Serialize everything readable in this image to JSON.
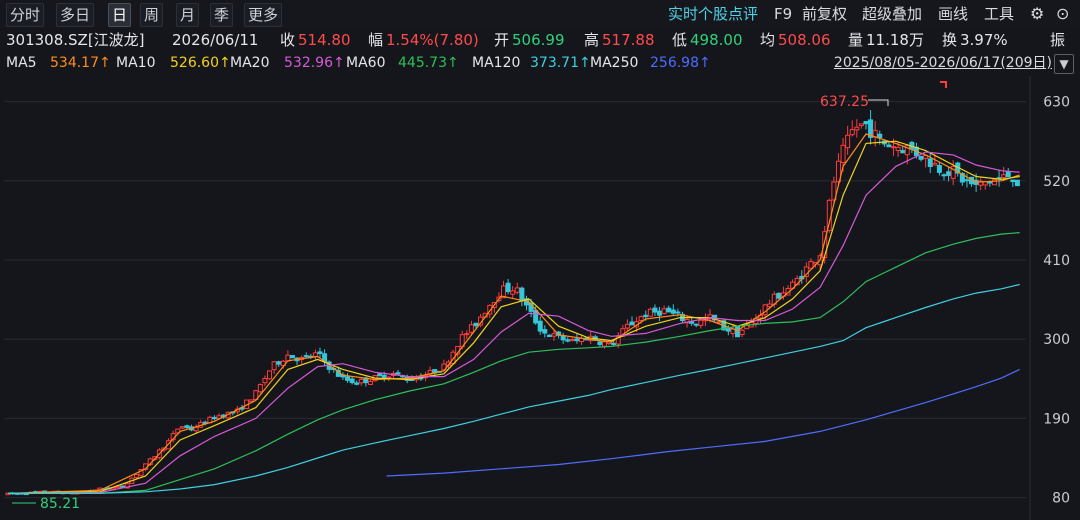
{
  "toolbar": {
    "tabs": [
      "分时",
      "多日",
      "日",
      "周",
      "月",
      "季",
      "更多"
    ],
    "active_tab": "日",
    "tools": [
      "实时个股点评",
      "F9",
      "前复权",
      "超级叠加",
      "画线",
      "工具"
    ],
    "gear_icon": "gear-icon",
    "chevron_icon": "chevron-down-icon"
  },
  "quote": {
    "code": "301308.SZ[江波龙]",
    "date": "2026/06/11",
    "close_label": "收",
    "close": "514.80",
    "change_label": "幅",
    "change": "1.54%(7.80)",
    "open_label": "开",
    "open": "506.99",
    "high_label": "高",
    "high": "517.88",
    "low_label": "低",
    "low": "498.00",
    "avg_label": "均",
    "avg": "508.06",
    "volume_label": "量",
    "volume": "11.18万",
    "turnover_label": "换",
    "turnover": "3.97%",
    "amplitude_label": "振"
  },
  "ma_legend": [
    {
      "name": "MA5",
      "value": "534.17",
      "color": "#ff8c1a"
    },
    {
      "name": "MA10",
      "value": "526.60",
      "color": "#f2d21e"
    },
    {
      "name": "MA20",
      "value": "532.96",
      "color": "#d65ad6"
    },
    {
      "name": "MA60",
      "value": "445.73",
      "color": "#2fbf5a"
    },
    {
      "name": "MA120",
      "value": "373.71",
      "color": "#3fd0e0"
    },
    {
      "name": "MA250",
      "value": "256.98",
      "color": "#4f6cff"
    }
  ],
  "range_text": "2025/08/05-2026/06/17(209日)",
  "chart_data": {
    "type": "candlestick",
    "ylim": [
      60,
      660
    ],
    "y_ticks": [
      "630",
      "520",
      "410",
      "300",
      "190",
      "80"
    ],
    "y_tick_values": [
      630,
      520,
      410,
      300,
      190,
      80
    ],
    "max_label": "637.25",
    "min_label": "85.21",
    "colors": {
      "up": "#ff3b3b",
      "down": "#34c6d9",
      "grid": "#262a32"
    },
    "anchors": [
      [
        0,
        85
      ],
      [
        18,
        88
      ],
      [
        28,
        86
      ],
      [
        40,
        92
      ],
      [
        50,
        95
      ],
      [
        60,
        125
      ],
      [
        70,
        158
      ],
      [
        75,
        180
      ],
      [
        80,
        175
      ],
      [
        90,
        192
      ],
      [
        100,
        200
      ],
      [
        108,
        225
      ],
      [
        115,
        262
      ],
      [
        122,
        278
      ],
      [
        128,
        272
      ],
      [
        135,
        280
      ],
      [
        140,
        262
      ],
      [
        146,
        245
      ],
      [
        152,
        240
      ],
      [
        160,
        246
      ],
      [
        168,
        252
      ],
      [
        175,
        244
      ],
      [
        182,
        250
      ],
      [
        190,
        262
      ],
      [
        197,
        300
      ],
      [
        203,
        318
      ],
      [
        209,
        345
      ],
      [
        215,
        368
      ],
      [
        221,
        372
      ],
      [
        227,
        340
      ],
      [
        233,
        310
      ],
      [
        240,
        302
      ],
      [
        247,
        296
      ],
      [
        253,
        304
      ],
      [
        259,
        296
      ],
      [
        263,
        292
      ],
      [
        270,
        318
      ],
      [
        278,
        335
      ],
      [
        286,
        340
      ],
      [
        293,
        330
      ],
      [
        300,
        322
      ],
      [
        306,
        330
      ],
      [
        312,
        316
      ],
      [
        318,
        308
      ],
      [
        324,
        322
      ],
      [
        330,
        345
      ],
      [
        336,
        362
      ],
      [
        342,
        375
      ],
      [
        348,
        398
      ],
      [
        354,
        420
      ],
      [
        357,
        470
      ],
      [
        360,
        520
      ],
      [
        364,
        560
      ],
      [
        369,
        595
      ],
      [
        374,
        598
      ],
      [
        380,
        575
      ],
      [
        387,
        568
      ],
      [
        393,
        565
      ],
      [
        400,
        552
      ],
      [
        406,
        538
      ],
      [
        412,
        532
      ],
      [
        417,
        520
      ],
      [
        422,
        512
      ],
      [
        428,
        520
      ],
      [
        433,
        522
      ],
      [
        437,
        530
      ],
      [
        441,
        515
      ]
    ],
    "ma_lines": [
      {
        "name": "MA5",
        "color": "#ff8c1a",
        "points": [
          [
            0,
            86
          ],
          [
            40,
            90
          ],
          [
            60,
            120
          ],
          [
            75,
            172
          ],
          [
            90,
            186
          ],
          [
            108,
            215
          ],
          [
            122,
            270
          ],
          [
            135,
            276
          ],
          [
            146,
            250
          ],
          [
            160,
            244
          ],
          [
            175,
            246
          ],
          [
            190,
            256
          ],
          [
            203,
            310
          ],
          [
            215,
            360
          ],
          [
            227,
            352
          ],
          [
            240,
            306
          ],
          [
            253,
            300
          ],
          [
            263,
            296
          ],
          [
            278,
            328
          ],
          [
            293,
            334
          ],
          [
            306,
            326
          ],
          [
            318,
            312
          ],
          [
            330,
            338
          ],
          [
            342,
            370
          ],
          [
            354,
            410
          ],
          [
            364,
            540
          ],
          [
            374,
            585
          ],
          [
            387,
            572
          ],
          [
            400,
            556
          ],
          [
            412,
            536
          ],
          [
            422,
            518
          ],
          [
            433,
            520
          ],
          [
            441,
            528
          ]
        ]
      },
      {
        "name": "MA10",
        "color": "#f2d21e",
        "points": [
          [
            0,
            86
          ],
          [
            40,
            88
          ],
          [
            60,
            110
          ],
          [
            75,
            160
          ],
          [
            90,
            180
          ],
          [
            108,
            205
          ],
          [
            122,
            258
          ],
          [
            135,
            272
          ],
          [
            146,
            258
          ],
          [
            160,
            246
          ],
          [
            175,
            244
          ],
          [
            190,
            252
          ],
          [
            203,
            295
          ],
          [
            215,
            345
          ],
          [
            227,
            356
          ],
          [
            240,
            318
          ],
          [
            253,
            302
          ],
          [
            263,
            298
          ],
          [
            278,
            318
          ],
          [
            293,
            330
          ],
          [
            306,
            330
          ],
          [
            318,
            318
          ],
          [
            330,
            330
          ],
          [
            342,
            356
          ],
          [
            354,
            395
          ],
          [
            364,
            500
          ],
          [
            374,
            572
          ],
          [
            387,
            575
          ],
          [
            400,
            562
          ],
          [
            412,
            542
          ],
          [
            422,
            526
          ],
          [
            433,
            522
          ],
          [
            441,
            526
          ]
        ]
      },
      {
        "name": "MA20",
        "color": "#d65ad6",
        "points": [
          [
            0,
            86
          ],
          [
            40,
            87
          ],
          [
            60,
            100
          ],
          [
            75,
            138
          ],
          [
            90,
            165
          ],
          [
            108,
            190
          ],
          [
            122,
            232
          ],
          [
            135,
            262
          ],
          [
            146,
            266
          ],
          [
            160,
            254
          ],
          [
            175,
            248
          ],
          [
            190,
            248
          ],
          [
            203,
            272
          ],
          [
            215,
            310
          ],
          [
            227,
            336
          ],
          [
            240,
            332
          ],
          [
            253,
            312
          ],
          [
            263,
            304
          ],
          [
            278,
            308
          ],
          [
            293,
            322
          ],
          [
            306,
            330
          ],
          [
            318,
            326
          ],
          [
            330,
            326
          ],
          [
            342,
            342
          ],
          [
            354,
            372
          ],
          [
            364,
            430
          ],
          [
            374,
            500
          ],
          [
            387,
            540
          ],
          [
            400,
            560
          ],
          [
            412,
            556
          ],
          [
            422,
            542
          ],
          [
            433,
            534
          ],
          [
            441,
            532
          ]
        ]
      },
      {
        "name": "MA60",
        "color": "#2fbf5a",
        "points": [
          [
            0,
            86
          ],
          [
            40,
            86
          ],
          [
            60,
            90
          ],
          [
            75,
            105
          ],
          [
            90,
            120
          ],
          [
            108,
            145
          ],
          [
            122,
            168
          ],
          [
            135,
            188
          ],
          [
            146,
            202
          ],
          [
            160,
            216
          ],
          [
            175,
            228
          ],
          [
            190,
            238
          ],
          [
            203,
            254
          ],
          [
            215,
            270
          ],
          [
            227,
            282
          ],
          [
            240,
            286
          ],
          [
            253,
            288
          ],
          [
            263,
            290
          ],
          [
            278,
            296
          ],
          [
            293,
            304
          ],
          [
            306,
            312
          ],
          [
            318,
            318
          ],
          [
            330,
            322
          ],
          [
            342,
            324
          ],
          [
            354,
            330
          ],
          [
            364,
            352
          ],
          [
            374,
            380
          ],
          [
            387,
            400
          ],
          [
            400,
            420
          ],
          [
            412,
            432
          ],
          [
            422,
            440
          ],
          [
            433,
            446
          ],
          [
            441,
            448
          ]
        ]
      },
      {
        "name": "MA120",
        "color": "#3fd0e0",
        "points": [
          [
            0,
            86
          ],
          [
            40,
            86
          ],
          [
            60,
            88
          ],
          [
            75,
            92
          ],
          [
            90,
            98
          ],
          [
            108,
            110
          ],
          [
            122,
            122
          ],
          [
            135,
            135
          ],
          [
            146,
            146
          ],
          [
            160,
            156
          ],
          [
            175,
            166
          ],
          [
            190,
            176
          ],
          [
            203,
            186
          ],
          [
            215,
            196
          ],
          [
            227,
            206
          ],
          [
            240,
            214
          ],
          [
            253,
            222
          ],
          [
            263,
            230
          ],
          [
            278,
            240
          ],
          [
            293,
            250
          ],
          [
            306,
            258
          ],
          [
            318,
            266
          ],
          [
            330,
            274
          ],
          [
            342,
            282
          ],
          [
            354,
            290
          ],
          [
            364,
            298
          ],
          [
            374,
            316
          ],
          [
            387,
            330
          ],
          [
            400,
            344
          ],
          [
            412,
            356
          ],
          [
            422,
            364
          ],
          [
            433,
            370
          ],
          [
            441,
            376
          ]
        ]
      },
      {
        "name": "MA250",
        "color": "#4f6cff",
        "points": [
          [
            165,
            110
          ],
          [
            190,
            114
          ],
          [
            215,
            120
          ],
          [
            240,
            126
          ],
          [
            263,
            134
          ],
          [
            288,
            144
          ],
          [
            306,
            150
          ],
          [
            330,
            158
          ],
          [
            354,
            172
          ],
          [
            374,
            188
          ],
          [
            387,
            200
          ],
          [
            400,
            212
          ],
          [
            412,
            224
          ],
          [
            422,
            234
          ],
          [
            433,
            246
          ],
          [
            441,
            258
          ]
        ]
      }
    ]
  }
}
